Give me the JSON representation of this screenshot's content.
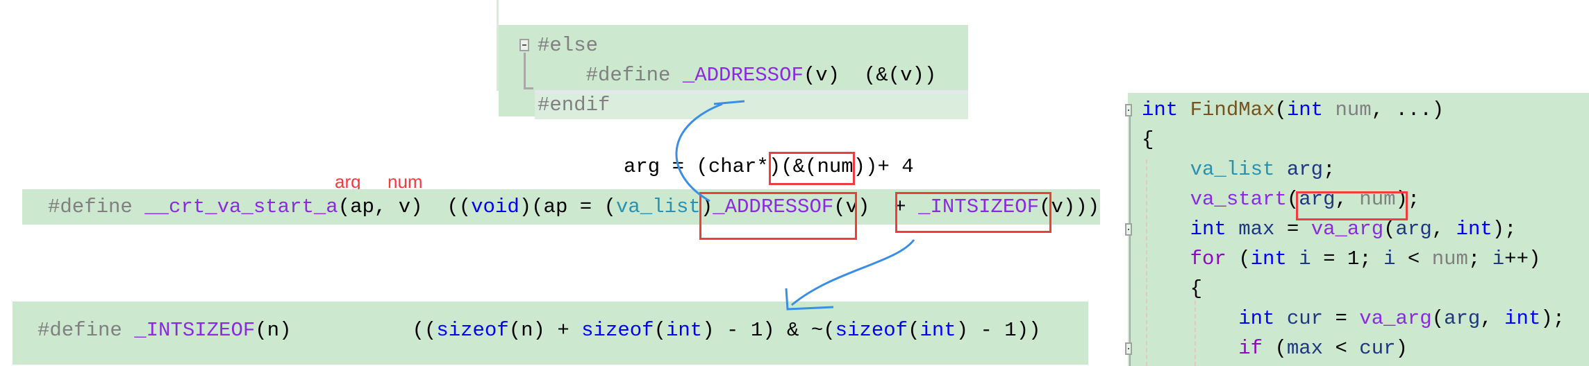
{
  "colors": {
    "background": "#cce8cf",
    "highlight_line": "#dbeedd",
    "annotation_red": "#f03c3c",
    "arrow_blue": "#3a8ee6",
    "tokens": {
      "pre": "#808080",
      "macro": "#8a2be2",
      "kw": "#0000ff",
      "type": "#2b91af",
      "param": "#808080",
      "func": "#74531f",
      "var": "#1f377f",
      "ctrl": "#8f08c4",
      "plain": "#000000"
    }
  },
  "top_snippet": {
    "lines": [
      [
        [
          "#else",
          "pre"
        ]
      ],
      [
        [
          "    #define ",
          "pre"
        ],
        [
          "_ADDRESSOF",
          "macro"
        ],
        [
          "(v)  (&(v))",
          "plain"
        ]
      ],
      [
        [
          "#endif",
          "pre"
        ]
      ]
    ]
  },
  "annotation_expansion": "arg = (char*)(&(num))+ 4",
  "annotation_labels": {
    "ap": "arg",
    "v": "num"
  },
  "va_start_snippet": {
    "lines": [
      [
        [
          "#define ",
          "pre"
        ],
        [
          "__crt_va_start_a",
          "macro"
        ],
        [
          "(ap, v)  ((",
          "plain"
        ],
        [
          "void",
          "kw"
        ],
        [
          ")(ap = (",
          "plain"
        ],
        [
          "va_list",
          "type"
        ],
        [
          ")",
          "plain"
        ],
        [
          "_ADDRESSOF",
          "macro"
        ],
        [
          "(v)  + ",
          "plain"
        ],
        [
          "_INTSIZEOF",
          "macro"
        ],
        [
          "(v)))",
          "plain"
        ]
      ]
    ]
  },
  "intsizeof_snippet": {
    "lines": [
      [
        [
          "#define ",
          "pre"
        ],
        [
          "_INTSIZEOF",
          "macro"
        ],
        [
          "(n)          ((",
          "plain"
        ],
        [
          "sizeof",
          "kw"
        ],
        [
          "(n) + ",
          "plain"
        ],
        [
          "sizeof",
          "kw"
        ],
        [
          "(",
          "plain"
        ],
        [
          "int",
          "kw"
        ],
        [
          ") - 1) & ~(",
          "plain"
        ],
        [
          "sizeof",
          "kw"
        ],
        [
          "(",
          "plain"
        ],
        [
          "int",
          "kw"
        ],
        [
          ") - 1))",
          "plain"
        ]
      ]
    ]
  },
  "findmax_snippet": {
    "lines": [
      [
        [
          "int",
          "kw"
        ],
        [
          " ",
          "plain"
        ],
        [
          "FindMax",
          "func"
        ],
        [
          "(",
          "plain"
        ],
        [
          "int",
          "kw"
        ],
        [
          " ",
          "plain"
        ],
        [
          "num",
          "param"
        ],
        [
          ", ...)",
          "plain"
        ]
      ],
      [
        [
          "{",
          "plain"
        ]
      ],
      [
        [
          "    ",
          "plain"
        ],
        [
          "va_list",
          "type"
        ],
        [
          " ",
          "plain"
        ],
        [
          "arg",
          "var"
        ],
        [
          ";",
          "plain"
        ]
      ],
      [
        [
          "    ",
          "plain"
        ],
        [
          "va_start",
          "macro"
        ],
        [
          "(",
          "plain"
        ],
        [
          "arg",
          "var"
        ],
        [
          ", ",
          "plain"
        ],
        [
          "num",
          "param"
        ],
        [
          ");",
          "plain"
        ]
      ],
      [
        [
          "    ",
          "plain"
        ],
        [
          "int",
          "kw"
        ],
        [
          " ",
          "plain"
        ],
        [
          "max",
          "var"
        ],
        [
          " = ",
          "plain"
        ],
        [
          "va_arg",
          "macro"
        ],
        [
          "(",
          "plain"
        ],
        [
          "arg",
          "var"
        ],
        [
          ", ",
          "plain"
        ],
        [
          "int",
          "kw"
        ],
        [
          ");",
          "plain"
        ]
      ],
      [
        [
          "    ",
          "plain"
        ],
        [
          "for",
          "ctrl"
        ],
        [
          " (",
          "plain"
        ],
        [
          "int",
          "kw"
        ],
        [
          " ",
          "plain"
        ],
        [
          "i",
          "var"
        ],
        [
          " = 1; ",
          "plain"
        ],
        [
          "i",
          "var"
        ],
        [
          " < ",
          "plain"
        ],
        [
          "num",
          "param"
        ],
        [
          "; ",
          "plain"
        ],
        [
          "i",
          "var"
        ],
        [
          "++)",
          "plain"
        ]
      ],
      [
        [
          "    {",
          "plain"
        ]
      ],
      [
        [
          "        ",
          "plain"
        ],
        [
          "int",
          "kw"
        ],
        [
          " ",
          "plain"
        ],
        [
          "cur",
          "var"
        ],
        [
          " = ",
          "plain"
        ],
        [
          "va_arg",
          "macro"
        ],
        [
          "(",
          "plain"
        ],
        [
          "arg",
          "var"
        ],
        [
          ", ",
          "plain"
        ],
        [
          "int",
          "kw"
        ],
        [
          ");",
          "plain"
        ]
      ],
      [
        [
          "        ",
          "plain"
        ],
        [
          "if",
          "ctrl"
        ],
        [
          " (",
          "plain"
        ],
        [
          "max",
          "var"
        ],
        [
          " < ",
          "plain"
        ],
        [
          "cur",
          "var"
        ],
        [
          ")",
          "plain"
        ]
      ]
    ]
  }
}
